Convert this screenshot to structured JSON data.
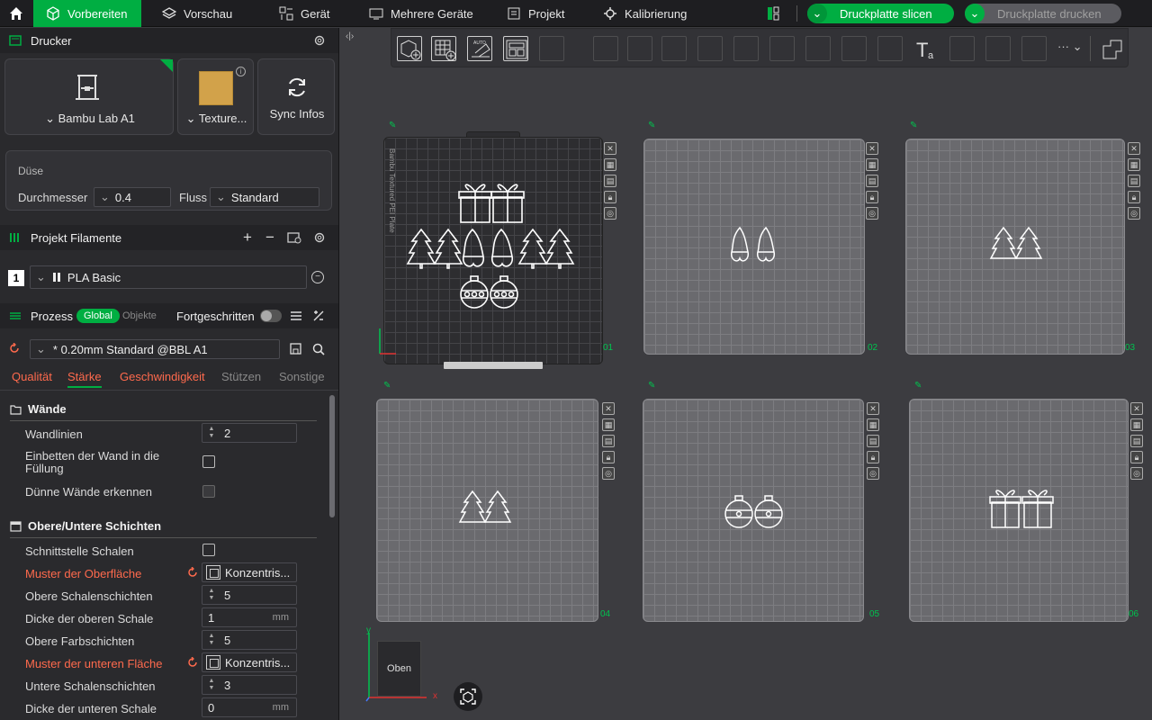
{
  "topbar": {
    "tabs": [
      {
        "label": "Vorbereiten",
        "icon": "cube-icon"
      },
      {
        "label": "Vorschau",
        "icon": "layers-icon"
      },
      {
        "label": "Gerät",
        "icon": "device-icon"
      },
      {
        "label": "Mehrere Geräte",
        "icon": "multi-device-icon"
      },
      {
        "label": "Projekt",
        "icon": "project-icon"
      },
      {
        "label": "Kalibrierung",
        "icon": "calibration-icon"
      }
    ],
    "slice_label": "Druckplatte slicen",
    "print_label": "Druckplatte drucken",
    "accent": "#00ae42"
  },
  "printer": {
    "section_title": "Drucker",
    "printer_name": "Bambu Lab A1",
    "plate_name": "Texture...",
    "sync_label": "Sync Infos",
    "nozzle_title": "Düse",
    "diameter_label": "Durchmesser",
    "diameter_value": "0.4",
    "flow_label": "Fluss",
    "flow_value": "Standard"
  },
  "filament": {
    "section_title": "Projekt Filamente",
    "slot": "1",
    "name": "PLA Basic"
  },
  "process": {
    "section_title": "Prozess",
    "toggle_global": "Global",
    "toggle_objects": "Objekte",
    "advanced_label": "Fortgeschritten",
    "preset": "* 0.20mm Standard @BBL A1",
    "tabs": [
      "Qualität",
      "Stärke",
      "Geschwindigkeit",
      "Stützen",
      "Sonstige"
    ],
    "walls_title": "Wände",
    "wall_loops_label": "Wandlinien",
    "wall_loops_value": "2",
    "embed_wall_label": "Einbetten der Wand in die Füllung",
    "thin_walls_label": "Dünne Wände erkennen",
    "topbottom_title": "Obere/Untere Schichten",
    "interface_label": "Schnittstelle Schalen",
    "top_pattern_label": "Muster der Oberfläche",
    "top_pattern_value": "Konzentris...",
    "top_shell_layers_label": "Obere Schalenschichten",
    "top_shell_layers_value": "5",
    "top_shell_thickness_label": "Dicke der oberen Schale",
    "top_shell_thickness_value": "1",
    "top_color_layers_label": "Obere Farbschichten",
    "top_color_layers_value": "5",
    "bottom_pattern_label": "Muster der unteren Fläche",
    "bottom_pattern_value": "Konzentris...",
    "bottom_shell_layers_label": "Untere Schalenschichten",
    "bottom_shell_layers_value": "3",
    "bottom_shell_thickness_label": "Dicke der unteren Schale",
    "bottom_shell_thickness_value": "0",
    "unit_mm": "mm"
  },
  "viewport": {
    "toolbar_more": "···",
    "plates": [
      {
        "num": "01",
        "objects": "gifts, trees, gnomes, ornaments"
      },
      {
        "num": "02",
        "objects": "gnomes"
      },
      {
        "num": "03",
        "objects": "trees"
      },
      {
        "num": "04",
        "objects": "trees"
      },
      {
        "num": "05",
        "objects": "ornaments"
      },
      {
        "num": "06",
        "objects": "gifts"
      }
    ],
    "plate_label": "Bambu Textured PEI Plate",
    "view_label": "Oben",
    "axis_x": "x",
    "axis_y": "y"
  }
}
